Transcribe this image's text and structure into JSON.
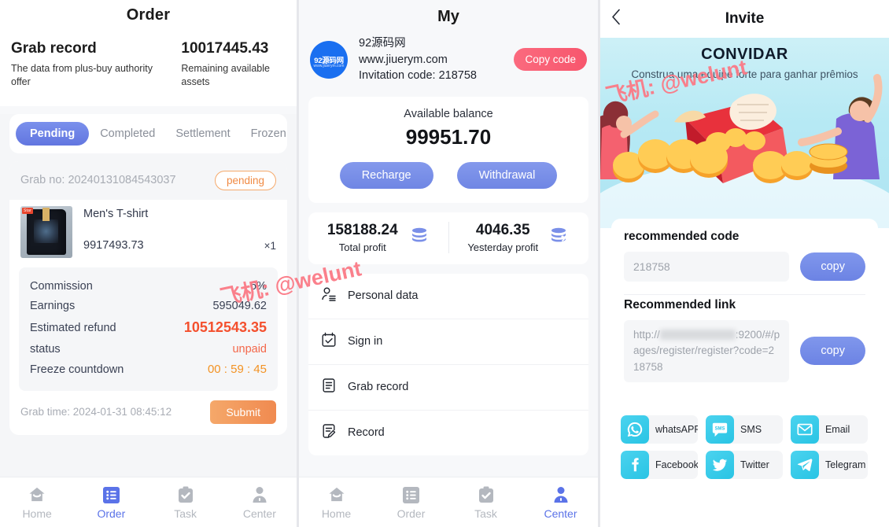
{
  "order_panel": {
    "title": "Order",
    "header": {
      "heading": "Grab record",
      "subtitle": "The data from plus-buy authority offer",
      "amount": "10017445.43",
      "amount_label": "Remaining available assets"
    },
    "tabs": [
      {
        "label": "Pending",
        "active": true
      },
      {
        "label": "Completed",
        "active": false
      },
      {
        "label": "Settlement",
        "active": false
      },
      {
        "label": "Frozen",
        "active": false
      }
    ],
    "card": {
      "grab_no_label": "Grab no:",
      "grab_no_value": "20240131084543037",
      "status_badge": "pending",
      "product_name": "Men's T-shirt",
      "product_price": "9917493.73",
      "product_qty": "×1",
      "thumb_tag": "Star",
      "details": [
        {
          "label": "Commission",
          "value": "6%",
          "style": "normal"
        },
        {
          "label": "Earnings",
          "value": "595049.62",
          "style": "normal"
        },
        {
          "label": "Estimated refund",
          "value": "10512543.35",
          "style": "accent"
        },
        {
          "label": "status",
          "value": "unpaid",
          "style": "unpaid"
        },
        {
          "label": "Freeze countdown",
          "value": "00 : 59 : 45",
          "style": "count"
        }
      ],
      "grab_time_label": "Grab time:",
      "grab_time_value": "2024-01-31 08:45:12",
      "submit_label": "Submit"
    },
    "tabbar": [
      {
        "label": "Home",
        "icon": "home-icon",
        "active": false
      },
      {
        "label": "Order",
        "icon": "list-icon",
        "active": true
      },
      {
        "label": "Task",
        "icon": "clipboard-check-icon",
        "active": false
      },
      {
        "label": "Center",
        "icon": "person-icon",
        "active": false
      }
    ]
  },
  "my_panel": {
    "title": "My",
    "user": {
      "avatar_line1": "92源码网",
      "avatar_line2": "www.jiuerym.com",
      "name": "92源码网",
      "site": "www.jiuerym.com",
      "invitation": "Invitation code: 218758",
      "copy_code_label": "Copy code"
    },
    "balance": {
      "label": "Available balance",
      "value": "99951.70",
      "recharge_label": "Recharge",
      "withdrawal_label": "Withdrawal"
    },
    "profit": [
      {
        "value": "158188.24",
        "label": "Total profit",
        "icon": "database-icon"
      },
      {
        "value": "4046.35",
        "label": "Yesterday profit",
        "icon": "database-percent-icon"
      }
    ],
    "menu": [
      {
        "label": "Personal data",
        "icon": "user-lines-icon"
      },
      {
        "label": "Sign in",
        "icon": "calendar-check-icon"
      },
      {
        "label": "Grab record",
        "icon": "document-lines-icon"
      },
      {
        "label": "Record",
        "icon": "document-edit-icon"
      }
    ],
    "tabbar": [
      {
        "label": "Home",
        "icon": "home-icon",
        "active": false
      },
      {
        "label": "Order",
        "icon": "list-icon",
        "active": false
      },
      {
        "label": "Task",
        "icon": "clipboard-check-icon",
        "active": false
      },
      {
        "label": "Center",
        "icon": "person-icon",
        "active": true
      }
    ]
  },
  "invite_panel": {
    "nav": {
      "back_icon": "chevron-left-icon",
      "title": "Invite"
    },
    "hero": {
      "headline": "CONVIDAR",
      "subline": "Construa uma equipe forte para ganhar prêmios"
    },
    "recommended_code": {
      "heading": "recommended code",
      "value": "218758",
      "copy_label": "copy"
    },
    "recommended_link": {
      "heading": "Recommended link",
      "prefix": "http://",
      "suffix": ":9200/#/pages/register/register?code=218758",
      "copy_label": "copy"
    },
    "share": [
      {
        "label": "whatsAPP",
        "icon": "whatsapp-icon"
      },
      {
        "label": "SMS",
        "icon": "sms-icon"
      },
      {
        "label": "Email",
        "icon": "email-icon"
      },
      {
        "label": "Facebook",
        "icon": "facebook-icon"
      },
      {
        "label": "Twitter",
        "icon": "twitter-icon"
      },
      {
        "label": "Telegram",
        "icon": "telegram-icon"
      }
    ]
  },
  "watermarks": [
    {
      "text": "飞机: @welunt"
    },
    {
      "text": "飞机: @welunt"
    }
  ],
  "colors": {
    "primary_blue": "#6c83e4",
    "accent_orange": "#f4502e",
    "badge_orange": "#f08a43",
    "pink_button": "#f7566d",
    "cyan_hero": "#aee4f2",
    "watermark_pink": "#fb7a86"
  }
}
